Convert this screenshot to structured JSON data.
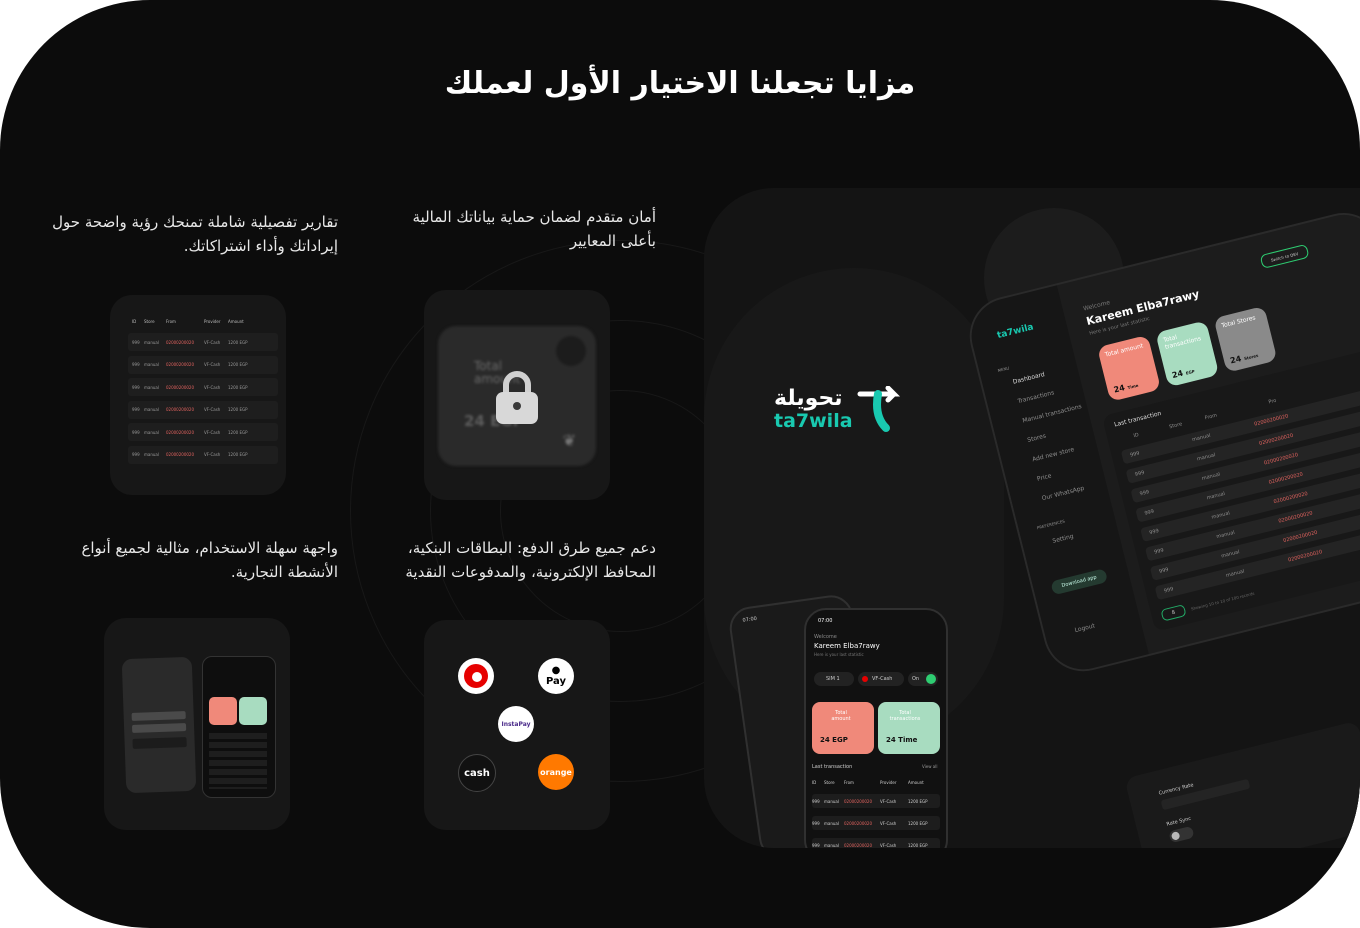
{
  "section_title": "مزايا تجعلنا الاختيار الأول لعملك",
  "features": {
    "reports": "تقارير تفصيلية شاملة تمنحك رؤية واضحة حول إيراداتك وأداء اشتراكاتك.",
    "security": "أمان متقدم لضمان حماية بياناتك المالية بأعلى المعايير",
    "usability": "واجهة سهلة الاستخدام، مثالية لجميع أنواع الأنشطة التجارية.",
    "payments": "دعم جميع طرق الدفع: البطاقات البنكية، المحافظ الإلكترونية، والمدفوعات النقدية"
  },
  "table_tile": {
    "headers": [
      "ID",
      "Store",
      "From",
      "Provider",
      "Amount"
    ],
    "rows": [
      [
        "999",
        "manual",
        "02000200020",
        "VF-Cash",
        "1200 EGP"
      ],
      [
        "999",
        "manual",
        "02000200020",
        "VF-Cash",
        "1200 EGP"
      ],
      [
        "999",
        "manual",
        "02000200020",
        "VF-Cash",
        "1200 EGP"
      ],
      [
        "999",
        "manual",
        "02000200020",
        "VF-Cash",
        "1200 EGP"
      ],
      [
        "999",
        "manual",
        "02000200020",
        "VF-Cash",
        "1200 EGP"
      ],
      [
        "999",
        "manual",
        "02000200020",
        "VF-Cash",
        "1200 EGP"
      ]
    ]
  },
  "lock_tile": {
    "label": "Total amount",
    "value": "24 EGP"
  },
  "payment_logos": {
    "vodafone": "vodafone",
    "apple_pay": "Pay",
    "instapay": "InstaPay",
    "etisalat": "cash",
    "orange": "orange"
  },
  "brand": {
    "arabic": "تحويلة",
    "latin": "ta7wila",
    "accent": "#19c9b0"
  },
  "dashboard": {
    "welcome": "Welcome",
    "name": "Kareem Elba7rawy",
    "sub": "Here is your last statistic",
    "switch": "Switch to DEV",
    "menu_label": "MENU",
    "menu": [
      "Dashboard",
      "Transactions",
      "Manual transactions",
      "Stores",
      "Add new store",
      "Price",
      "Our WhatsApp"
    ],
    "pref_label": "PREFERENCES",
    "setting": "Setting",
    "download": "Download app",
    "logout": "Logout",
    "stats": [
      {
        "label": "Total amount",
        "value": "24",
        "unit": "Time"
      },
      {
        "label": "Total transactions",
        "value": "24",
        "unit": "EGP"
      },
      {
        "label": "Total Stores",
        "value": "24",
        "unit": "Stores"
      }
    ],
    "last_tx": "Last transaction",
    "tx_headers": [
      "ID",
      "Store",
      "From",
      "Pro"
    ],
    "tx_rows": [
      [
        "999",
        "manual",
        "02000200020"
      ],
      [
        "999",
        "manual",
        "02000200020"
      ],
      [
        "999",
        "manual",
        "02000200020"
      ],
      [
        "999",
        "manual",
        "02000200020"
      ],
      [
        "999",
        "manual",
        "02000200020"
      ],
      [
        "999",
        "manual",
        "02000200020"
      ],
      [
        "999",
        "manual",
        "02000200020"
      ],
      [
        "999",
        "manual",
        "02000200020"
      ]
    ],
    "paging": "Showing 10 to 10 of 100 records",
    "page": "8"
  },
  "phone": {
    "time": "07:00",
    "time2": "07:00",
    "welcome": "Welcome",
    "name": "Kareem Elba7rawy",
    "sub": "Here is your last statistic",
    "sim": "SIM 1",
    "wallet": "VF-Cash",
    "toggle": "On",
    "card1_label": "Total amount",
    "card1_value": "24 EGP",
    "card2_label": "Total transactions",
    "card2_value": "24 Time",
    "last_tx": "Last transaction",
    "view_all": "View all",
    "headers": [
      "ID",
      "Store",
      "From",
      "Provider",
      "Amount"
    ],
    "rows": [
      [
        "999",
        "manual",
        "02000200020",
        "VF-Cash",
        "1200 EGP"
      ],
      [
        "999",
        "manual",
        "02000200020",
        "VF-Cash",
        "1200 EGP"
      ],
      [
        "999",
        "manual",
        "02000200020",
        "VF-Cash",
        "1200 EGP"
      ]
    ]
  },
  "settings_panel": {
    "currency": "Currency Rate",
    "rate_sync": "Rate Sync"
  },
  "colors": {
    "salmon": "#f0897a",
    "mint": "#a8dcc0",
    "grey_card": "#8a8a8a",
    "green": "#2ecc71"
  }
}
